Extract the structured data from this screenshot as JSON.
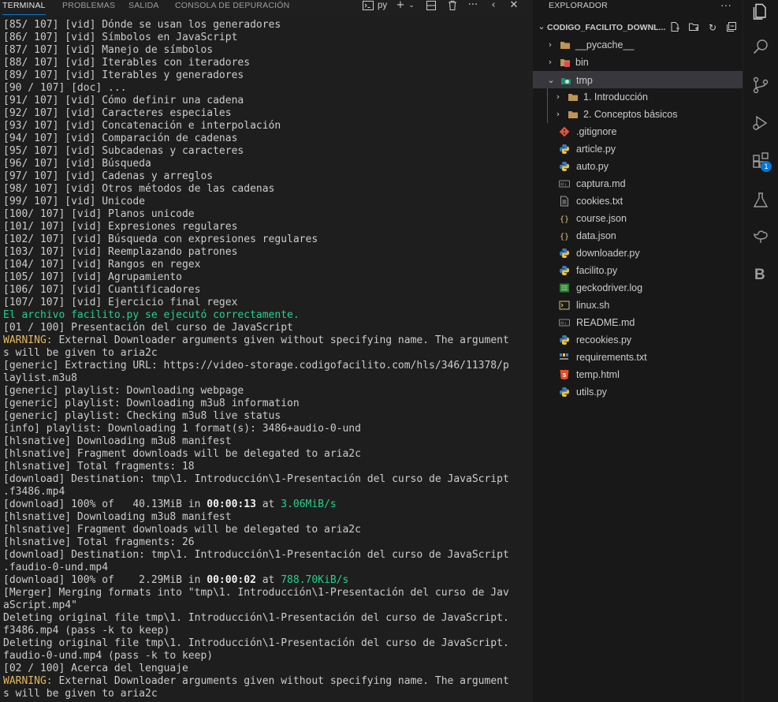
{
  "panel": {
    "tabs": [
      {
        "label": "TERMINAL",
        "active": true
      },
      {
        "label": "PROBLEMAS",
        "active": false
      },
      {
        "label": "SALIDA",
        "active": false
      },
      {
        "label": "CONSOLA DE DEPURACIÓN",
        "active": false
      }
    ],
    "shell_label": "py",
    "toolbar_icons": [
      "terminal-icon",
      "add-icon",
      "chevron-down-icon",
      "split-icon",
      "trash-icon",
      "more-icon",
      "chevron-left-icon",
      "close-icon"
    ]
  },
  "terminal": {
    "lines": [
      "[85/ 107] [vid] Dónde se usan los generadores",
      "[86/ 107] [vid] Símbolos en JavaScript",
      "[87/ 107] [vid] Manejo de símbolos",
      "[88/ 107] [vid] Iterables con iteradores",
      "[89/ 107] [vid] Iterables y generadores",
      "[90 / 107] [doc] ...",
      "[91/ 107] [vid] Cómo definir una cadena",
      "[92/ 107] [vid] Caracteres especiales",
      "[93/ 107] [vid] Concatenación e interpolación",
      "[94/ 107] [vid] Comparación de cadenas",
      "[95/ 107] [vid] Subcadenas y caracteres",
      "[96/ 107] [vid] Búsqueda",
      "[97/ 107] [vid] Cadenas y arreglos",
      "[98/ 107] [vid] Otros métodos de las cadenas",
      "[99/ 107] [vid] Unicode",
      "[100/ 107] [vid] Planos unicode",
      "[101/ 107] [vid] Expresiones regulares",
      "[102/ 107] [vid] Búsqueda con expresiones regulares",
      "[103/ 107] [vid] Reemplazando patrones",
      "[104/ 107] [vid] Rangos en regex",
      "[105/ 107] [vid] Agrupamiento",
      "[106/ 107] [vid] Cuantificadores",
      "[107/ 107] [vid] Ejercicio final regex",
      "El archivo facilito.py se ejecutó correctamente.",
      "[01 / 100] Presentación del curso de JavaScript",
      "External Downloader arguments given without specifying name. The argument",
      "s will be given to aria2c",
      "[generic] Extracting URL: https://video-storage.codigofacilito.com/hls/346/11378/p",
      "laylist.m3u8",
      "[generic] playlist: Downloading webpage",
      "[generic] playlist: Downloading m3u8 information",
      "[generic] playlist: Checking m3u8 live status",
      "[info] playlist: Downloading 1 format(s): 3486+audio-0-und",
      "[hlsnative] Downloading m3u8 manifest",
      "[hlsnative] Fragment downloads will be delegated to aria2c",
      "[hlsnative] Total fragments: 18",
      "[download] Destination: tmp\\1. Introducción\\1-Presentación del curso de JavaScript",
      ".f3486.mp4",
      "[download] 100% of   40.13MiB in ",
      "[hlsnative] Downloading m3u8 manifest",
      "[hlsnative] Fragment downloads will be delegated to aria2c",
      "[hlsnative] Total fragments: 26",
      "[download] Destination: tmp\\1. Introducción\\1-Presentación del curso de JavaScript",
      ".faudio-0-und.mp4",
      "[download] 100% of    2.29MiB in ",
      "[Merger] Merging formats into \"tmp\\1. Introducción\\1-Presentación del curso de Jav",
      "aScript.mp4\"",
      "Deleting original file tmp\\1. Introducción\\1-Presentación del curso de JavaScript.",
      "f3486.mp4 (pass -k to keep)",
      "Deleting original file tmp\\1. Introducción\\1-Presentación del curso de JavaScript.",
      "faudio-0-und.mp4 (pass -k to keep)",
      "[02 / 100] Acerca del lenguaje",
      "External Downloader arguments given without specifying name. The argument",
      "s will be given to aria2c"
    ],
    "warning_prefix": "WARNING: ",
    "warning_lines": [
      25,
      52
    ],
    "success_lines": [
      23
    ],
    "progress": [
      {
        "line": 38,
        "time": "00:00:13",
        "at": " at ",
        "speed": "3.06MiB/s"
      },
      {
        "line": 44,
        "time": "00:00:02",
        "at": " at ",
        "speed": "788.70KiB/s"
      }
    ],
    "colors": {
      "success": "#23d18b",
      "warning": "#e5b95c",
      "speed": "#23d18b"
    }
  },
  "explorer": {
    "title": "EXPLORADOR",
    "root": "CODIGO_FACILITO_DOWNL...",
    "tree": [
      {
        "label": "__pycache__",
        "type": "folder",
        "level": 0,
        "chevron": "right",
        "icon": "folder-icon"
      },
      {
        "label": "bin",
        "type": "folder",
        "level": 0,
        "chevron": "right",
        "icon": "folder-bin-icon"
      },
      {
        "label": "tmp",
        "type": "folder",
        "level": 0,
        "chevron": "down",
        "icon": "folder-tmp-icon",
        "selected": true
      },
      {
        "label": "1. Introducción",
        "type": "folder",
        "level": 1,
        "chevron": "right",
        "icon": "folder-icon"
      },
      {
        "label": "2. Conceptos básicos",
        "type": "folder",
        "level": 1,
        "chevron": "right",
        "icon": "folder-icon"
      },
      {
        "label": ".gitignore",
        "type": "file",
        "level": 0,
        "icon": "git-icon"
      },
      {
        "label": "article.py",
        "type": "file",
        "level": 0,
        "icon": "python-icon"
      },
      {
        "label": "auto.py",
        "type": "file",
        "level": 0,
        "icon": "python-icon"
      },
      {
        "label": "captura.md",
        "type": "file",
        "level": 0,
        "icon": "markdown-icon"
      },
      {
        "label": "cookies.txt",
        "type": "file",
        "level": 0,
        "icon": "text-file-icon"
      },
      {
        "label": "course.json",
        "type": "file",
        "level": 0,
        "icon": "json-icon"
      },
      {
        "label": "data.json",
        "type": "file",
        "level": 0,
        "icon": "json-icon"
      },
      {
        "label": "downloader.py",
        "type": "file",
        "level": 0,
        "icon": "python-icon"
      },
      {
        "label": "facilito.py",
        "type": "file",
        "level": 0,
        "icon": "python-icon"
      },
      {
        "label": "geckodriver.log",
        "type": "file",
        "level": 0,
        "icon": "log-icon"
      },
      {
        "label": "linux.sh",
        "type": "file",
        "level": 0,
        "icon": "shell-icon"
      },
      {
        "label": "README.md",
        "type": "file",
        "level": 0,
        "icon": "markdown-icon"
      },
      {
        "label": "recookies.py",
        "type": "file",
        "level": 0,
        "icon": "python-icon"
      },
      {
        "label": "requirements.txt",
        "type": "file",
        "level": 0,
        "icon": "requirements-icon"
      },
      {
        "label": "temp.html",
        "type": "file",
        "level": 0,
        "icon": "html-icon"
      },
      {
        "label": "utils.py",
        "type": "file",
        "level": 0,
        "icon": "python-icon"
      }
    ]
  },
  "activity_bar": {
    "items": [
      "files-icon",
      "search-icon",
      "source-control-icon",
      "run-debug-icon",
      "extensions-icon",
      "testing-icon",
      "remote-icon",
      "b-extension-icon"
    ],
    "extensions_badge": "1",
    "b_label": "B"
  }
}
